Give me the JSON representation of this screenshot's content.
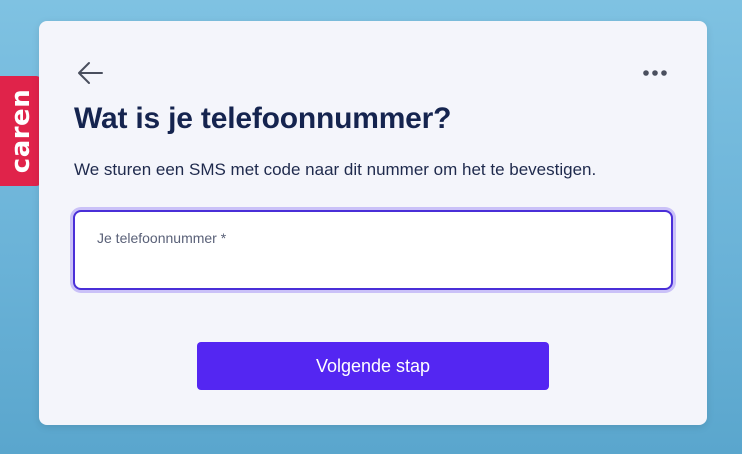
{
  "brand": {
    "name": "caren",
    "color": "#e0234a"
  },
  "header": {
    "back_icon": "arrow-left-icon",
    "more_icon": "more-horizontal-icon"
  },
  "main": {
    "title": "Wat is je telefoonnummer?",
    "subtitle": "We sturen een SMS met code naar dit nummer om het te bevestigen.",
    "phone_field": {
      "label": "Je telefoonnummer *",
      "value": ""
    },
    "submit_label": "Volgende stap"
  },
  "colors": {
    "accent": "#5426f2",
    "title": "#15244f",
    "focus_border": "#4a2fd8"
  }
}
